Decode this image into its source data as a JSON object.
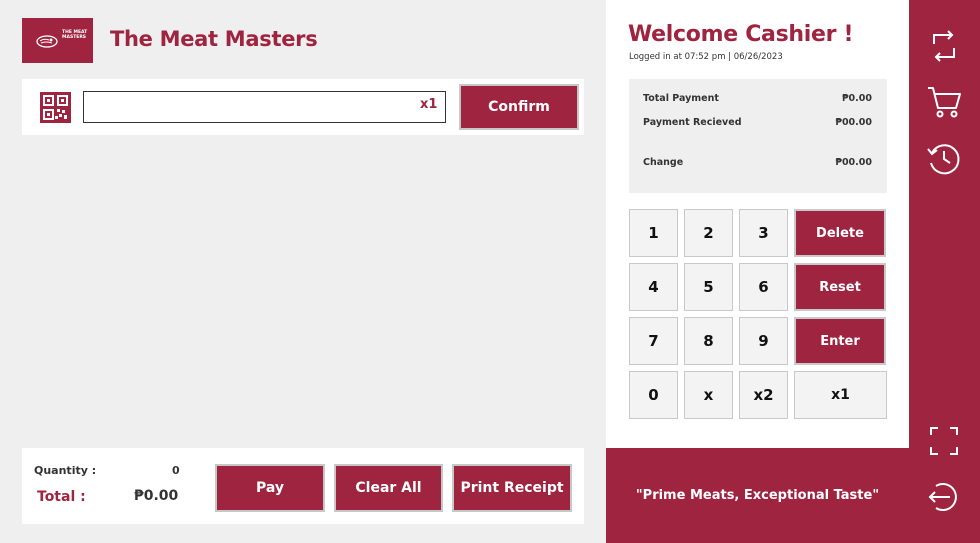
{
  "header": {
    "logo_text": "THE MEAT MASTERS",
    "brand": "The Meat Masters"
  },
  "scan": {
    "input_value": "",
    "multiplier": "x1",
    "confirm_label": "Confirm"
  },
  "summary_bar": {
    "quantity_label": "Quantity :",
    "quantity_value": "0",
    "total_label": "Total :",
    "total_value": "₱0.00"
  },
  "actions": {
    "pay": "Pay",
    "clear_all": "Clear All",
    "print_receipt": "Print Receipt"
  },
  "welcome": {
    "title": "Welcome Cashier !",
    "login_info": "Logged in at 07:52 pm | 06/26/2023"
  },
  "payment": {
    "total_payment_label": "Total Payment",
    "total_payment_value": "₱0.00",
    "payment_received_label": "Payment Recieved",
    "payment_received_value": "₱00.00",
    "change_label": "Change",
    "change_value": "₱00.00"
  },
  "keypad": {
    "k1": "1",
    "k2": "2",
    "k3": "3",
    "delete": "Delete",
    "k4": "4",
    "k5": "5",
    "k6": "6",
    "reset": "Reset",
    "k7": "7",
    "k8": "8",
    "k9": "9",
    "enter": "Enter",
    "k0": "0",
    "kx": "x",
    "kx2": "x2",
    "kx1": "x1"
  },
  "slogan": "\"Prime Meats, Exceptional Taste\"",
  "sidebar": {
    "icons": [
      "swap-icon",
      "cart-icon",
      "history-icon",
      "fullscreen-icon",
      "logout-icon"
    ]
  },
  "colors": {
    "accent": "#9e2440",
    "background": "#efefef",
    "panel": "#ffffff"
  }
}
